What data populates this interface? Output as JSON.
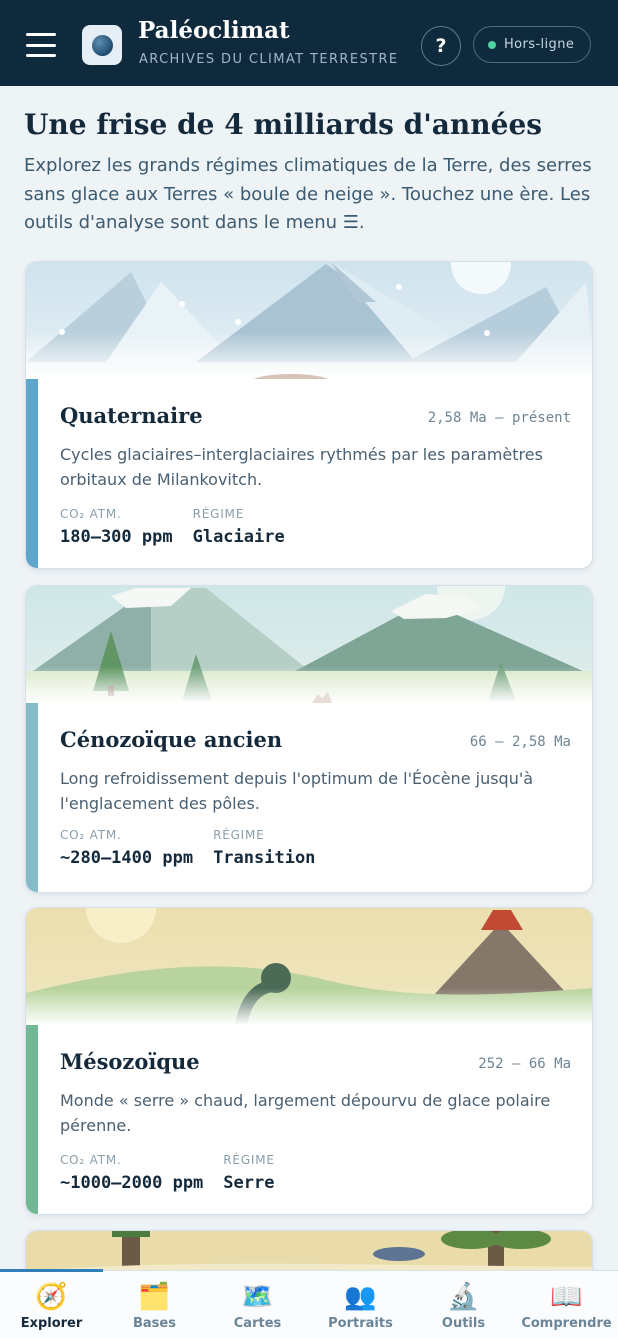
{
  "header": {
    "title": "Paléoclimat",
    "subtitle": "ARCHIVES DU CLIMAT TERRESTRE",
    "help_label": "?",
    "status_label": "Hors-ligne"
  },
  "intro": {
    "title": "Une frise de 4 milliards d'années",
    "text": "Explorez les grands régimes climatiques de la Terre, des serres sans glace aux Terres « boule de neige ». Touchez une ère. Les outils d'analyse sont dans le menu ☰."
  },
  "eras": [
    {
      "name": "Quaternaire",
      "range": "2,58 Ma – présent",
      "description": "Cycles glaciaires–interglaciaires rythmés par les paramètres orbitaux de Milankovitch.",
      "co2_label": "CO₂ ATM.",
      "co2_value": "180–300 ppm",
      "regime_label": "RÉGIME",
      "regime_value": "Glaciaire",
      "accent_color": "#5ea6cc"
    },
    {
      "name": "Cénozoïque ancien",
      "range": "66 – 2,58 Ma",
      "description": "Long refroidissement depuis l'optimum de l'Éocène jusqu'à l'englacement des pôles.",
      "co2_label": "CO₂ ATM.",
      "co2_value": "~280–1400 ppm",
      "regime_label": "RÉGIME",
      "regime_value": "Transition",
      "accent_color": "#86bcc7"
    },
    {
      "name": "Mésozoïque",
      "range": "252 – 66 Ma",
      "description": "Monde « serre » chaud, largement dépourvu de glace polaire pérenne.",
      "co2_label": "CO₂ ATM.",
      "co2_value": "~1000–2000 ppm",
      "regime_label": "RÉGIME",
      "regime_value": "Serre",
      "accent_color": "#72b895"
    }
  ],
  "nav": [
    {
      "label": "Explorer",
      "icon": "🧭",
      "icon_name": "compass-icon",
      "active": true
    },
    {
      "label": "Bases",
      "icon": "🗂️",
      "icon_name": "folder-icon",
      "active": false
    },
    {
      "label": "Cartes",
      "icon": "🗺️",
      "icon_name": "map-icon",
      "active": false
    },
    {
      "label": "Portraits",
      "icon": "👥",
      "icon_name": "people-icon",
      "active": false
    },
    {
      "label": "Outils",
      "icon": "🔬",
      "icon_name": "microscope-icon",
      "active": false
    },
    {
      "label": "Comprendre",
      "icon": "📖",
      "icon_name": "book-icon",
      "active": false
    }
  ]
}
